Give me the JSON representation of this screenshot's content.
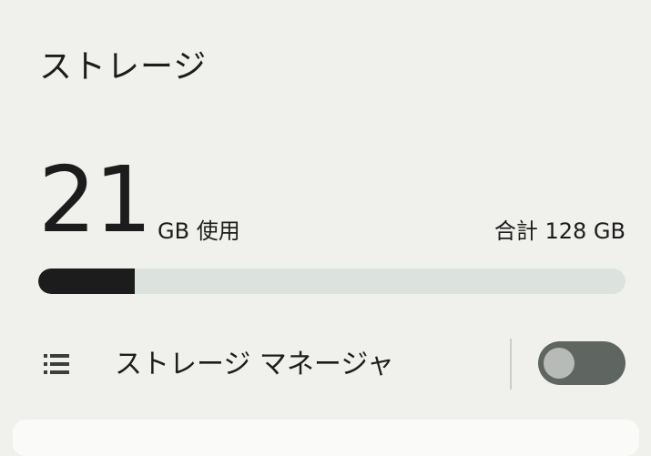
{
  "page": {
    "title": "ストレージ"
  },
  "storage": {
    "used_value": "21",
    "used_label": "GB 使用",
    "total_label": "合計 128 GB",
    "used_fraction": 0.164,
    "bar_fill_color": "#1c1c1c",
    "bar_track_color": "#dce3df"
  },
  "storage_manager": {
    "icon": "storage-list-icon",
    "label": "ストレージ マネージャ",
    "toggle_on": false
  }
}
